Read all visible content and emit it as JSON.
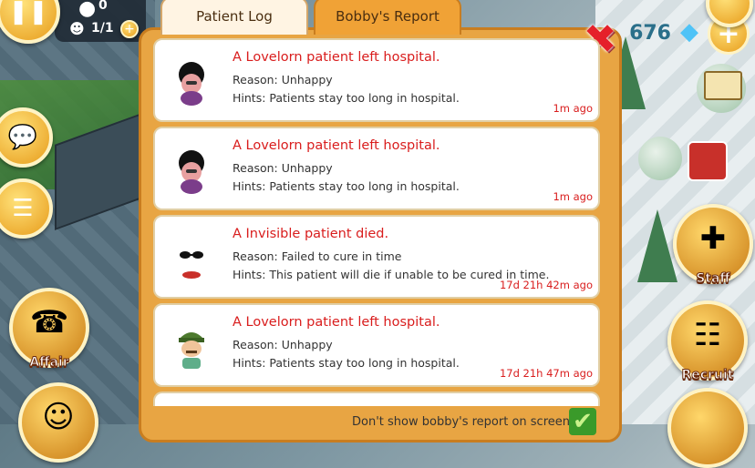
{
  "hud": {
    "top_left_count": "0",
    "staff_ratio": "1/1",
    "diamonds": "676"
  },
  "side_buttons": {
    "affair_label": "Affair",
    "staff_label": "Staff",
    "recruit_label": "Recruit"
  },
  "tabs": [
    {
      "label": "Patient Log",
      "active": true
    },
    {
      "label": "Bobby's Report",
      "active": false
    }
  ],
  "log_entries": [
    {
      "avatar": "afro-lady-patient",
      "title": "A Lovelorn patient left hospital.",
      "reason": "Reason: Unhappy",
      "hint": "Hints: Patients stay too long in hospital.",
      "time": "1m ago"
    },
    {
      "avatar": "afro-lady-patient",
      "title": "A Lovelorn patient left hospital.",
      "reason": "Reason: Unhappy",
      "hint": "Hints: Patients stay too long in hospital.",
      "time": "1m ago"
    },
    {
      "avatar": "invisible-patient-sunglasses",
      "title": "A Invisible patient died.",
      "reason": "Reason: Failed to cure in time",
      "hint": "Hints: This patient will die if unable to be cured in time.",
      "time": "17d 21h 42m ago"
    },
    {
      "avatar": "green-cap-patient",
      "title": "A Lovelorn patient left hospital.",
      "reason": "Reason: Unhappy",
      "hint": "Hints: Patients stay too long in hospital.",
      "time": "17d 21h 47m ago"
    }
  ],
  "footer": {
    "checkbox_label": "Don't show bobby's report on screen",
    "checked": true
  }
}
